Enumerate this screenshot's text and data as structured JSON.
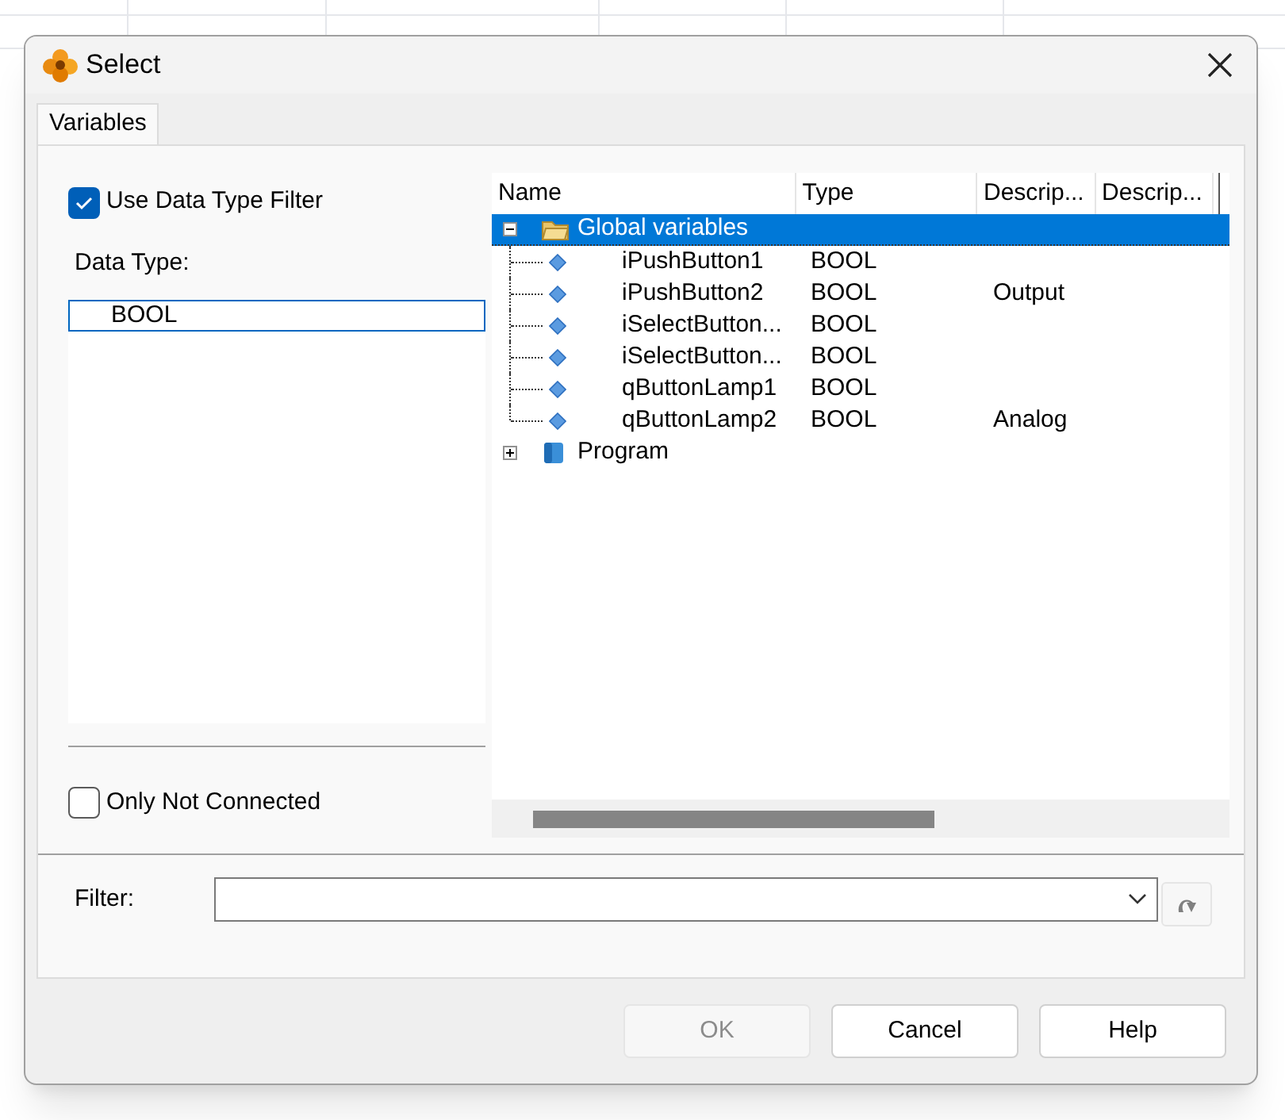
{
  "window": {
    "title": "Select"
  },
  "tabs": [
    {
      "label": "Variables",
      "selected": true
    }
  ],
  "use_data_type_filter": {
    "label": "Use Data Type Filter",
    "checked": true
  },
  "data_type": {
    "label": "Data Type:",
    "items": [
      {
        "text": "BOOL",
        "selected": true
      }
    ]
  },
  "only_not_connected": {
    "label": "Only Not Connected",
    "checked": false
  },
  "tree": {
    "columns": [
      "Name",
      "Type",
      "Descrip...",
      "Descrip..."
    ],
    "nodes": [
      {
        "name": "Global variables",
        "kind": "folder",
        "expanded": true,
        "selected": true,
        "children": [
          {
            "name": "iPushButton1",
            "type": "BOOL"
          },
          {
            "name": "iPushButton2",
            "type": "BOOL",
            "description": "Output"
          },
          {
            "name": "iSelectButton...",
            "type": "BOOL"
          },
          {
            "name": "iSelectButton...",
            "type": "BOOL"
          },
          {
            "name": "qButtonLamp1",
            "type": "BOOL"
          },
          {
            "name": "qButtonLamp2",
            "type": "BOOL",
            "description": "Analog"
          }
        ]
      },
      {
        "name": "Program",
        "kind": "program",
        "expanded": false,
        "selected": false
      }
    ]
  },
  "filter": {
    "label": "Filter:"
  },
  "buttons": [
    {
      "label": "OK",
      "disabled": true
    },
    {
      "label": "Cancel",
      "disabled": false
    },
    {
      "label": "Help",
      "disabled": false
    }
  ]
}
